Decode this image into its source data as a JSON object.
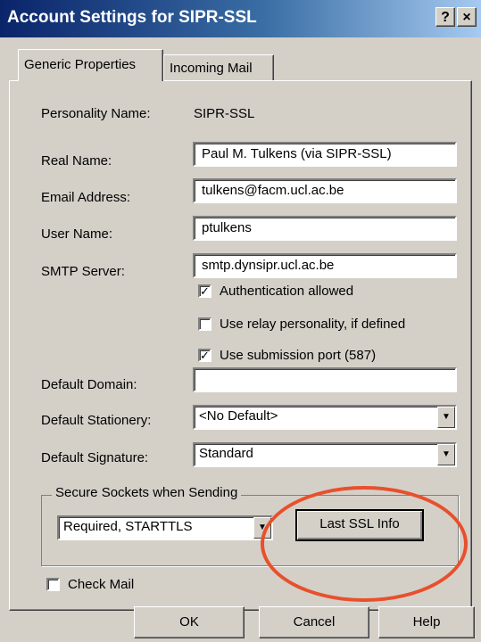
{
  "window": {
    "title": "Account Settings for SIPR-SSL",
    "help_btn": "?",
    "close_btn": "×"
  },
  "tabs": [
    {
      "label": "Generic Properties"
    },
    {
      "label": "Incoming Mail"
    }
  ],
  "personality": {
    "label": "Personality Name:",
    "value": "SIPR-SSL"
  },
  "real_name": {
    "label": "Real Name:",
    "value": "Paul M. Tulkens (via SIPR-SSL)"
  },
  "email": {
    "label": "Email Address:",
    "value": "tulkens@facm.ucl.ac.be"
  },
  "user_name": {
    "label": "User Name:",
    "value": "ptulkens"
  },
  "smtp": {
    "label": "SMTP Server:",
    "value": "smtp.dynsipr.ucl.ac.be"
  },
  "checks": {
    "auth": {
      "label": "Authentication allowed",
      "checked": true
    },
    "relay": {
      "label": "Use relay personality, if defined",
      "checked": false
    },
    "submission": {
      "label": "Use submission port (587)",
      "checked": true
    }
  },
  "default_domain": {
    "label": "Default Domain:",
    "value": ""
  },
  "default_stationery": {
    "label": "Default Stationery:",
    "value": "<No Default>"
  },
  "default_signature": {
    "label": "Default Signature:",
    "value": "Standard"
  },
  "ssl": {
    "group_label": "Secure Sockets when Sending",
    "value": "Required, STARTTLS",
    "button": "Last SSL Info"
  },
  "check_mail": {
    "label": "Check Mail",
    "checked": false
  },
  "buttons": {
    "ok": "OK",
    "cancel": "Cancel",
    "help": "Help"
  },
  "colors": {
    "titlebar_start": "#0a246a",
    "titlebar_end": "#a6caf0",
    "annotation": "#e8502c"
  }
}
